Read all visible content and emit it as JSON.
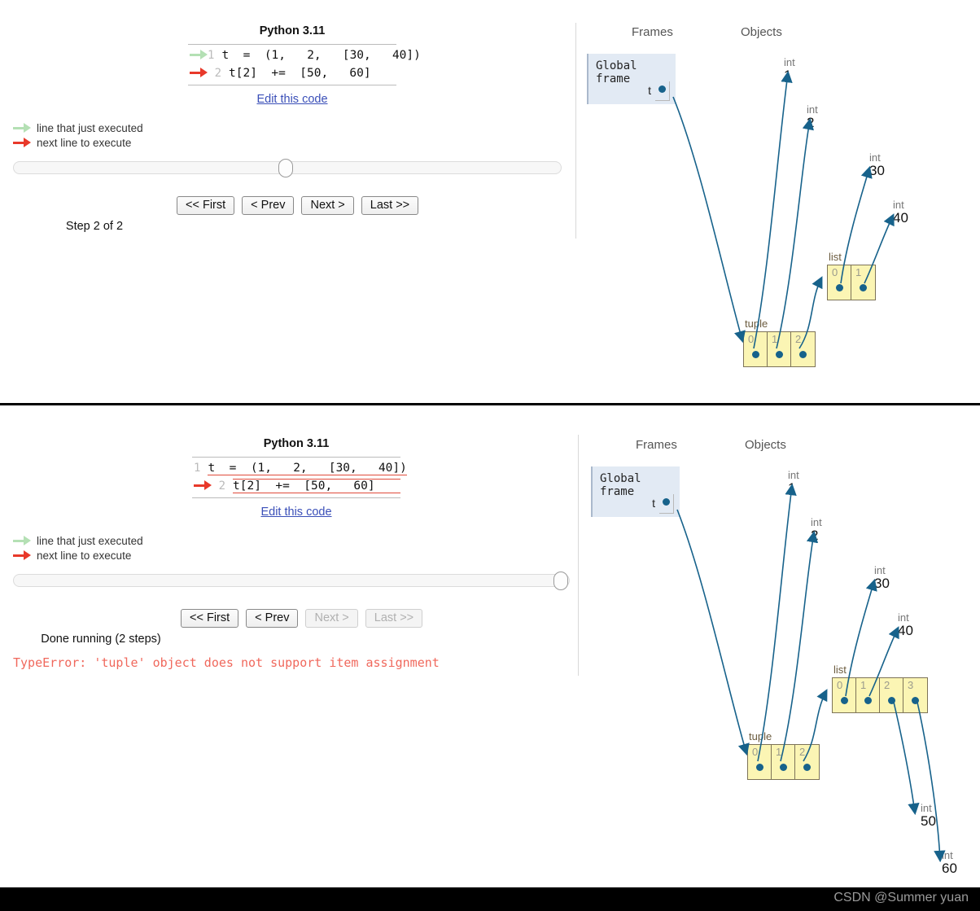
{
  "watermark": "CSDN @Summer yuan",
  "legend": {
    "just_executed": "line that just executed",
    "next_line": "next line to execute"
  },
  "panels": [
    {
      "id": "top",
      "python_version": "Python 3.11",
      "edit_link": "Edit this code",
      "code_lines": [
        {
          "num": "1",
          "text": "t  =  (1,   2,   [30,   40])",
          "marker": "green"
        },
        {
          "num": "2",
          "text": "t[2]  +=  [50,   60]",
          "marker": "red"
        }
      ],
      "buttons": {
        "first": "<< First",
        "prev": "< Prev",
        "next": "Next >",
        "last": "Last >>"
      },
      "step_label": "Step 2 of 2",
      "error_message": "",
      "viz": {
        "frames_header": "Frames",
        "objects_header": "Objects",
        "frame_title": "Global frame",
        "frame_var": "t",
        "tuple_label": "tuple",
        "tuple_cells": [
          "0",
          "1",
          "2"
        ],
        "list_label": "list",
        "list_cells": [
          "0",
          "1"
        ],
        "primitives": [
          {
            "type": "int",
            "value": "1"
          },
          {
            "type": "int",
            "value": "2"
          },
          {
            "type": "int",
            "value": "30"
          },
          {
            "type": "int",
            "value": "40"
          }
        ]
      }
    },
    {
      "id": "bottom",
      "python_version": "Python 3.11",
      "edit_link": "Edit this code",
      "code_lines": [
        {
          "num": "1",
          "text": "t  =  (1,   2,   [30,   40])",
          "marker": "none"
        },
        {
          "num": "2",
          "text": "t[2]  +=  [50,   60]",
          "marker": "red"
        }
      ],
      "buttons": {
        "first": "<< First",
        "prev": "< Prev",
        "next": "Next >",
        "last": "Last >>"
      },
      "step_label": "Done running (2 steps)",
      "error_message": "TypeError: 'tuple' object does not support item assignment",
      "viz": {
        "frames_header": "Frames",
        "objects_header": "Objects",
        "frame_title": "Global frame",
        "frame_var": "t",
        "tuple_label": "tuple",
        "tuple_cells": [
          "0",
          "1",
          "2"
        ],
        "list_label": "list",
        "list_cells": [
          "0",
          "1",
          "2",
          "3"
        ],
        "primitives": [
          {
            "type": "int",
            "value": "1"
          },
          {
            "type": "int",
            "value": "2"
          },
          {
            "type": "int",
            "value": "30"
          },
          {
            "type": "int",
            "value": "40"
          },
          {
            "type": "int",
            "value": "50"
          },
          {
            "type": "int",
            "value": "60"
          }
        ]
      }
    }
  ]
}
